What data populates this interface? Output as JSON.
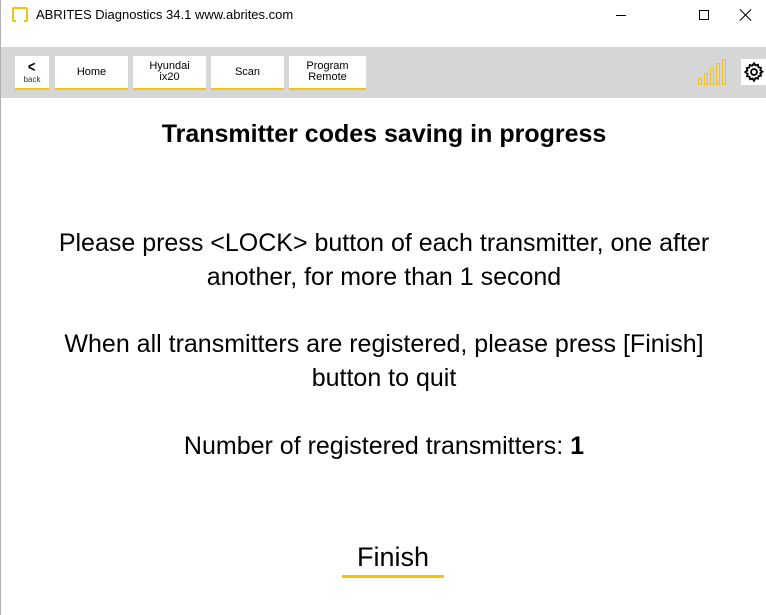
{
  "window": {
    "title": "ABRITES Diagnostics 34.1   www.abrites.com",
    "accent_color": "#f2c21a",
    "toolbar_color": "#d6d6d6"
  },
  "toolbar": {
    "back_label": "back",
    "back_icon": "chevron-left-icon",
    "home_label": "Home",
    "model_label_line1": "Hyundai",
    "model_label_line2": "ix20",
    "scan_label": "Scan",
    "program_label_line1": "Program",
    "program_label_line2": "Remote",
    "signal_icon": "signal-strength-icon",
    "settings_icon": "gear-icon"
  },
  "main": {
    "heading": "Transmitter codes saving in progress",
    "instruction": "Please press <LOCK> button of each transmitter, one after another, for more than 1 second",
    "finish_instruction": "When all transmitters are registered, please press [Finish] button to quit",
    "count_label": "Number of registered transmitters: ",
    "count_value": "1",
    "finish_label": "Finish"
  }
}
